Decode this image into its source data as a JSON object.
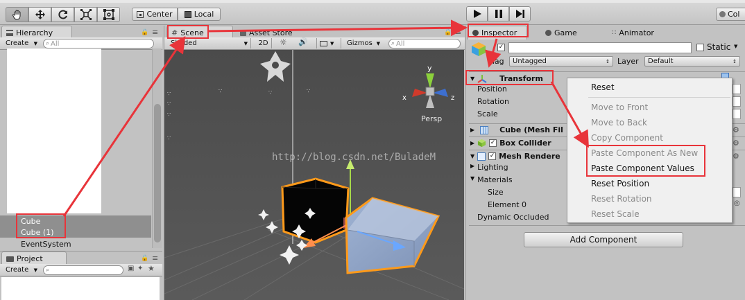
{
  "toolbar": {
    "pivot_label": "Center",
    "space_label": "Local",
    "right_label": "Col"
  },
  "hierarchy": {
    "tab_label": "Hierarchy",
    "create_label": "Create",
    "search_placeholder": "All",
    "items": [
      "Cube",
      "Cube (1)",
      "EventSystem"
    ]
  },
  "project": {
    "tab_label": "Project",
    "create_label": "Create"
  },
  "scene": {
    "tabs": [
      "Scene",
      "Asset Store"
    ],
    "shading": "Shaded",
    "mode_2d": "2D",
    "gizmos_label": "Gizmos",
    "search_placeholder": "All",
    "persp_label": "Persp",
    "gizmo_y": "y",
    "gizmo_x": "x",
    "gizmo_z": "z",
    "watermark": "http://blog.csdn.net/BuladeM"
  },
  "inspector": {
    "tabs": [
      "Inspector",
      "Game",
      "Animator"
    ],
    "object_name": "",
    "static_label": "Static",
    "tag_label": "Tag",
    "tag_value": "Untagged",
    "layer_label": "Layer",
    "layer_value": "Default",
    "transform": {
      "title": "Transform",
      "fields": [
        "Position",
        "Rotation",
        "Scale"
      ]
    },
    "components": [
      "Cube (Mesh Fil",
      "Box Collider",
      "Mesh Rendere"
    ],
    "renderer_props": [
      "Lighting",
      "Materials",
      "Size",
      "Element 0",
      "Dynamic Occluded"
    ],
    "add_component_label": "Add Component"
  },
  "context_menu": {
    "items": [
      {
        "label": "Reset",
        "enabled": true
      },
      {
        "label": "Move to Front",
        "enabled": false
      },
      {
        "label": "Move to Back",
        "enabled": false
      },
      {
        "label": "Copy Component",
        "enabled": false
      },
      {
        "label": "Paste Component As New",
        "enabled": false
      },
      {
        "label": "Paste Component Values",
        "enabled": true
      },
      {
        "label": "Reset Position",
        "enabled": true
      },
      {
        "label": "Reset Rotation",
        "enabled": false
      },
      {
        "label": "Reset Scale",
        "enabled": false
      }
    ]
  },
  "colors": {
    "annotation": "#e8343a",
    "selection_orange": "#ff9a1a",
    "scene_bg": "#4a4a4a"
  }
}
